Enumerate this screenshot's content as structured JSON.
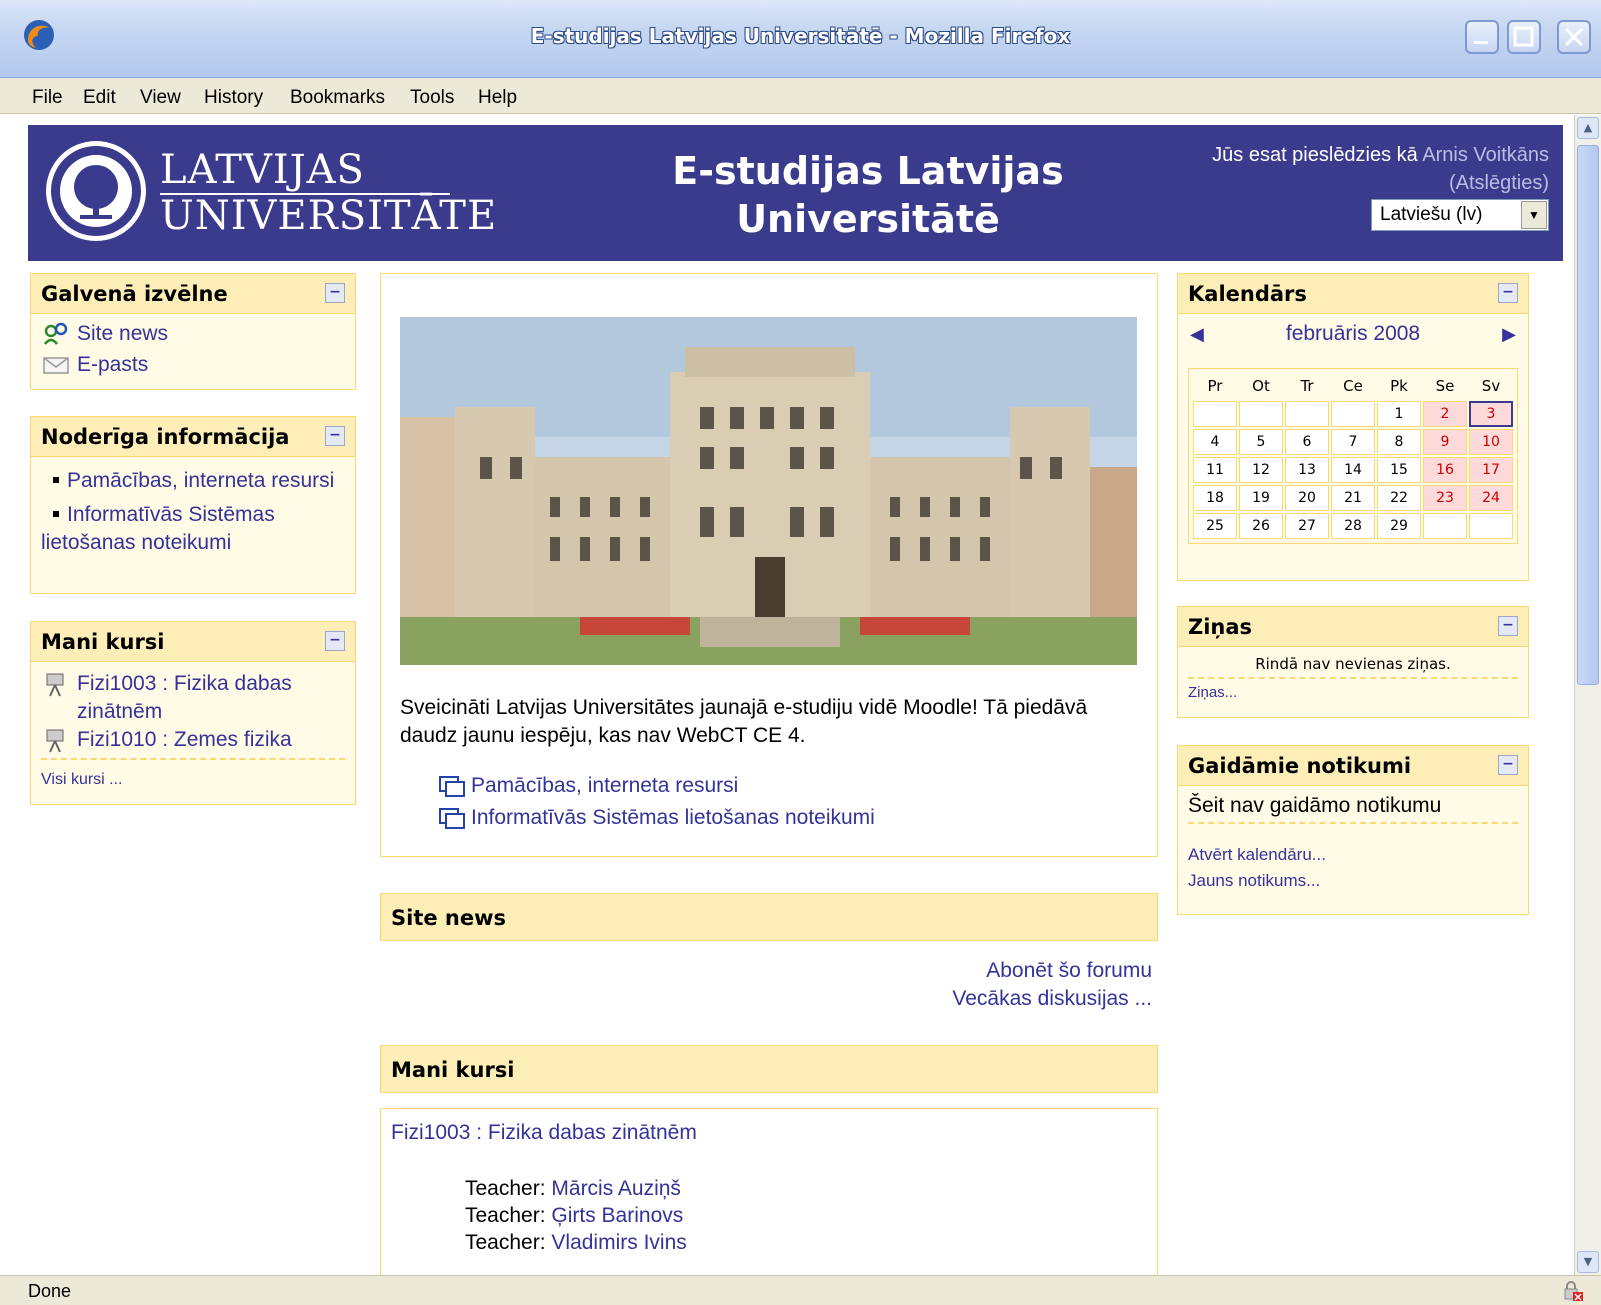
{
  "window": {
    "title": "E-studijas Latvijas Universitātē - Mozilla Firefox"
  },
  "menu": [
    "File",
    "Edit",
    "View",
    "History",
    "Bookmarks",
    "Tools",
    "Help"
  ],
  "status": {
    "text": "Done"
  },
  "header": {
    "logo_line1": "LATVIJAS",
    "logo_line2": "UNIVERSITĀTE",
    "site_title": "E-studijas Latvijas Universitātē",
    "login_prefix": "Jūs esat pieslēdzies kā",
    "user_name": "Arnis Voitkāns",
    "logout": "(Atslēgties)",
    "language": "Latviešu (lv)"
  },
  "blocks": {
    "main_menu": {
      "title": "Galvenā izvēlne",
      "items": [
        "Site news",
        "E-pasts"
      ]
    },
    "useful_info": {
      "title": "Noderīga informācija",
      "items": [
        "Pamācības, interneta resursi",
        "Informatīvās Sistēmas lietošanas noteikumi"
      ]
    },
    "my_courses": {
      "title": "Mani kursi",
      "items": [
        "Fizi1003 : Fizika dabas zinātnēm",
        "Fizi1010 : Zemes fizika"
      ],
      "all_link": "Visi kursi ..."
    },
    "calendar": {
      "title": "Kalendārs",
      "month": "februāris 2008",
      "weekdays": [
        "Pr",
        "Ot",
        "Tr",
        "Ce",
        "Pk",
        "Se",
        "Sv"
      ],
      "weeks": [
        [
          "",
          "",
          "",
          "",
          "1",
          "2",
          "3"
        ],
        [
          "4",
          "5",
          "6",
          "7",
          "8",
          "9",
          "10"
        ],
        [
          "11",
          "12",
          "13",
          "14",
          "15",
          "16",
          "17"
        ],
        [
          "18",
          "19",
          "20",
          "21",
          "22",
          "23",
          "24"
        ],
        [
          "25",
          "26",
          "27",
          "28",
          "29",
          "",
          ""
        ]
      ]
    },
    "news": {
      "title": "Ziņas",
      "empty": "Rindā nav nevienas ziņas.",
      "link": "Ziņas..."
    },
    "upcoming": {
      "title": "Gaidāmie notikumi",
      "empty": "Šeit nav gaidāmo notikumu",
      "open_calendar": "Atvērt kalendāru...",
      "new_event": "Jauns notikums..."
    }
  },
  "center": {
    "welcome": "Sveicināti Latvijas Universitātes jaunajā e-studiju vidē Moodle! Tā piedāvā daudz jaunu iespēju, kas nav WebCT CE 4.",
    "links": [
      "Pamācības, interneta resursi",
      "Informatīvās Sistēmas lietošanas noteikumi"
    ],
    "site_news_title": "Site news",
    "subscribe": "Abonēt šo forumu",
    "older": "Vecākas diskusijas ...",
    "my_courses_title": "Mani kursi",
    "course_name": "Fizi1003 : Fizika dabas zinātnēm",
    "teacher_label": "Teacher:",
    "teachers": [
      "Mārcis Auziņš",
      "Ģirts Barinovs",
      "Vladimirs Ivins"
    ]
  }
}
